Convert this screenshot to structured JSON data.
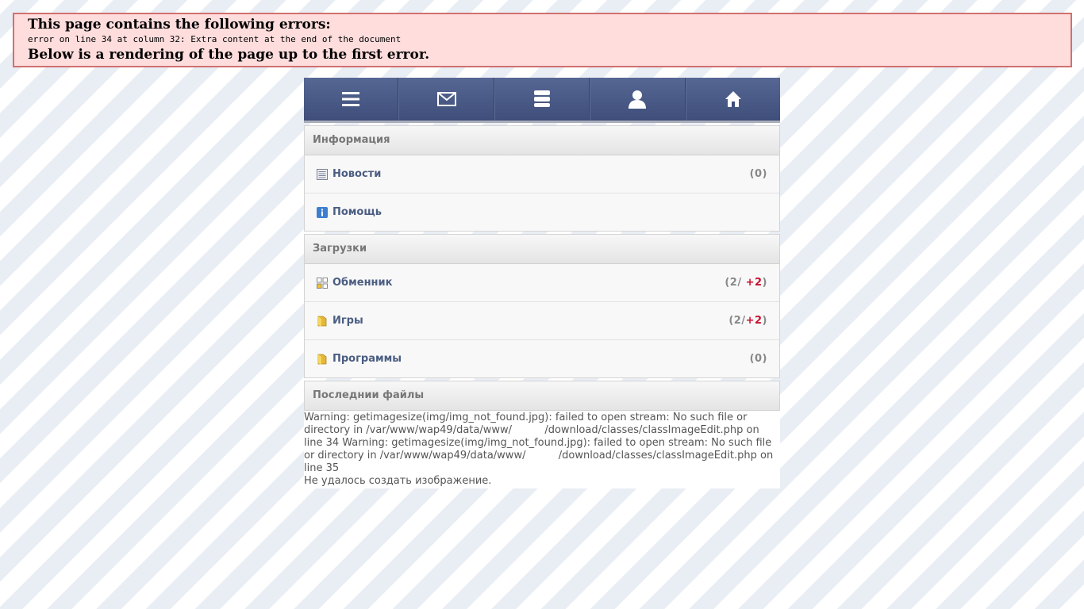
{
  "parser_error": {
    "title": "This page contains the following errors:",
    "message": "error on line 34 at column 32: Extra content at the end of the document",
    "footer": "Below is a rendering of the page up to the first error."
  },
  "nav": {
    "items": [
      {
        "icon": "menu-icon"
      },
      {
        "icon": "mail-icon"
      },
      {
        "icon": "chat-icon"
      },
      {
        "icon": "user-icon"
      },
      {
        "icon": "home-icon"
      }
    ]
  },
  "info": {
    "title": "Информация",
    "news": {
      "label": "Новости",
      "count": "(0)"
    },
    "help": {
      "label": "Помощь"
    }
  },
  "downloads": {
    "title": "Загрузки",
    "exchanger": {
      "label": "Обменник",
      "count_pre": "(2/ ",
      "count_new": "+2",
      "count_post": ")"
    },
    "games": {
      "label": "Игры",
      "count_pre": "(2/",
      "count_new": "+2",
      "count_post": ")"
    },
    "programs": {
      "label": "Программы",
      "count": "(0)"
    }
  },
  "latest": {
    "title": "Последнии файлы",
    "warning": "Warning: getimagesize(img/img_not_found.jpg): failed to open stream: No such file or directory in /var/www/wap49/data/www/          /download/classes/classImageEdit.php on line 34 Warning: getimagesize(img/img_not_found.jpg): failed to open stream: No such file or directory in /var/www/wap49/data/www/          /download/classes/classImageEdit.php on line 35",
    "failed": "Не удалось создать изображение."
  },
  "colors": {
    "nav_bg": "#4a5a86",
    "link": "#4b5d82",
    "new_count": "#c8102e",
    "error_bg": "#ffdddd",
    "error_border": "#d07070"
  }
}
